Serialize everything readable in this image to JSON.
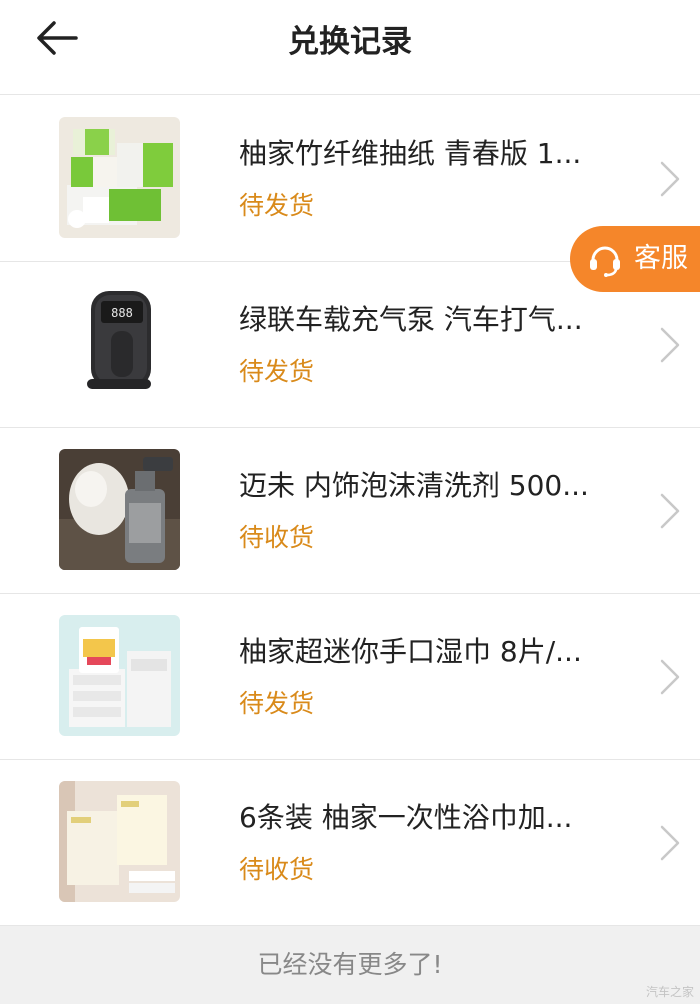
{
  "header": {
    "title": "兑换记录"
  },
  "service": {
    "label": "客服"
  },
  "items": [
    {
      "title": "柚家竹纤维抽纸 青春版 1...",
      "status": "待发货"
    },
    {
      "title": "绿联车载充气泵 汽车打气...",
      "status": "待发货"
    },
    {
      "title": "迈未 内饰泡沫清洗剂 500...",
      "status": "待收货"
    },
    {
      "title": "柚家超迷你手口湿巾 8片/...",
      "status": "待发货"
    },
    {
      "title": "6条装 柚家一次性浴巾加...",
      "status": "待收货"
    }
  ],
  "footer": {
    "text": "已经没有更多了!"
  },
  "watermark": "汽车之家",
  "colors": {
    "status": "#d98a1a",
    "service_bg": "#f5862a",
    "divider": "#e6e6e6",
    "footer_bg": "#f0f0f0"
  }
}
